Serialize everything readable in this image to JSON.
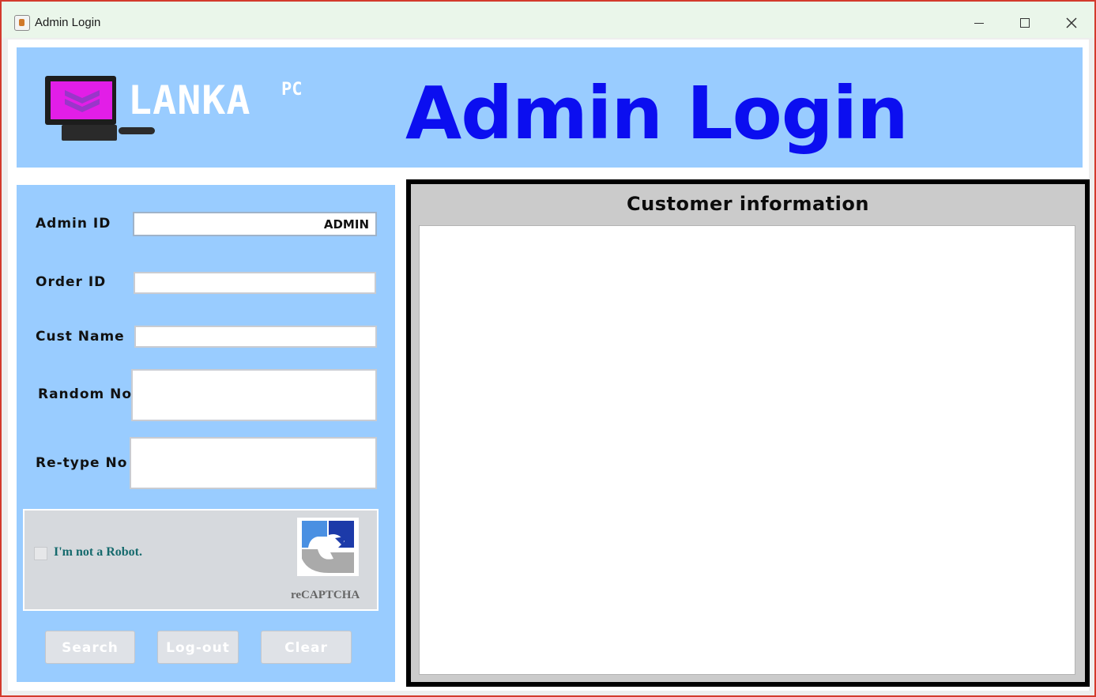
{
  "window": {
    "title": "Admin Login",
    "controls": {
      "minimize": "minimize",
      "maximize": "maximize",
      "close": "close"
    }
  },
  "banner": {
    "logo_text": "LANKA",
    "logo_sub": "PC",
    "title": "Admin Login"
  },
  "form": {
    "admin_id": {
      "label": "Admin ID",
      "value": "ADMIN"
    },
    "order_id": {
      "label": "Order ID",
      "value": ""
    },
    "cust_name": {
      "label": "Cust Name",
      "value": ""
    },
    "random_no": {
      "label": "Random No",
      "value": ""
    },
    "retype_no": {
      "label": "Re-type No",
      "value": ""
    }
  },
  "captcha": {
    "checkbox_label": "I'm not a Robot.",
    "checked": false,
    "brand": "reCAPTCHA"
  },
  "buttons": {
    "search": "Search",
    "logout": "Log-out",
    "clear": "Clear"
  },
  "customer_panel": {
    "title": "Customer information",
    "content": ""
  },
  "colors": {
    "panel_bg": "#99ccff",
    "title_blue": "#0b0ef0",
    "window_border": "#d33a2c",
    "logo_screen": "#e21ee7"
  }
}
